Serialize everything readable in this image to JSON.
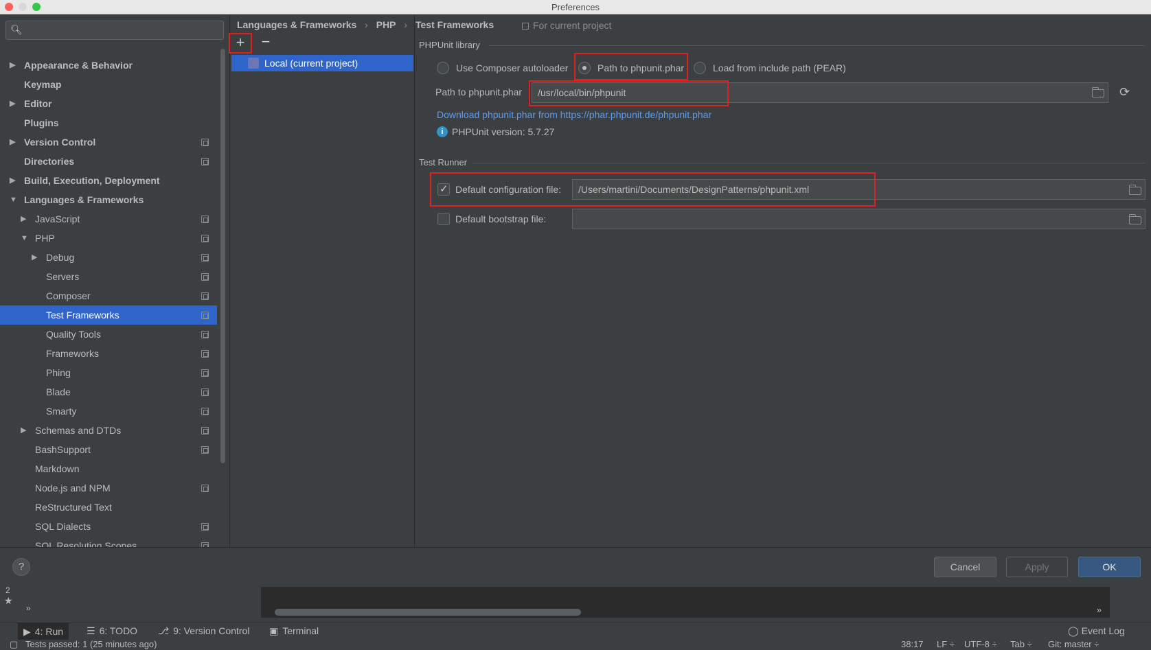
{
  "window": {
    "title": "Preferences"
  },
  "search": {
    "placeholder": ""
  },
  "tree": {
    "items": [
      {
        "label": "Appearance & Behavior",
        "bold": true,
        "arrow": "▶",
        "indent": 0,
        "copy": false
      },
      {
        "label": "Keymap",
        "bold": true,
        "arrow": "",
        "indent": 0,
        "copy": false
      },
      {
        "label": "Editor",
        "bold": true,
        "arrow": "▶",
        "indent": 0,
        "copy": false
      },
      {
        "label": "Plugins",
        "bold": true,
        "arrow": "",
        "indent": 0,
        "copy": false
      },
      {
        "label": "Version Control",
        "bold": true,
        "arrow": "▶",
        "indent": 0,
        "copy": true
      },
      {
        "label": "Directories",
        "bold": true,
        "arrow": "",
        "indent": 0,
        "copy": true
      },
      {
        "label": "Build, Execution, Deployment",
        "bold": true,
        "arrow": "▶",
        "indent": 0,
        "copy": false
      },
      {
        "label": "Languages & Frameworks",
        "bold": true,
        "arrow": "▼",
        "indent": 0,
        "copy": false
      },
      {
        "label": "JavaScript",
        "bold": false,
        "arrow": "▶",
        "indent": 1,
        "copy": true
      },
      {
        "label": "PHP",
        "bold": false,
        "arrow": "▼",
        "indent": 1,
        "copy": true
      },
      {
        "label": "Debug",
        "bold": false,
        "arrow": "▶",
        "indent": 2,
        "copy": true
      },
      {
        "label": "Servers",
        "bold": false,
        "arrow": "",
        "indent": 2,
        "copy": true
      },
      {
        "label": "Composer",
        "bold": false,
        "arrow": "",
        "indent": 2,
        "copy": true
      },
      {
        "label": "Test Frameworks",
        "bold": false,
        "arrow": "",
        "indent": 2,
        "copy": true,
        "selected": true
      },
      {
        "label": "Quality Tools",
        "bold": false,
        "arrow": "",
        "indent": 2,
        "copy": true
      },
      {
        "label": "Frameworks",
        "bold": false,
        "arrow": "",
        "indent": 2,
        "copy": true
      },
      {
        "label": "Phing",
        "bold": false,
        "arrow": "",
        "indent": 2,
        "copy": true
      },
      {
        "label": "Blade",
        "bold": false,
        "arrow": "",
        "indent": 2,
        "copy": true
      },
      {
        "label": "Smarty",
        "bold": false,
        "arrow": "",
        "indent": 2,
        "copy": true
      },
      {
        "label": "Schemas and DTDs",
        "bold": false,
        "arrow": "▶",
        "indent": 1,
        "copy": true
      },
      {
        "label": "BashSupport",
        "bold": false,
        "arrow": "",
        "indent": 1,
        "copy": true
      },
      {
        "label": "Markdown",
        "bold": false,
        "arrow": "",
        "indent": 1,
        "copy": false
      },
      {
        "label": "Node.js and NPM",
        "bold": false,
        "arrow": "",
        "indent": 1,
        "copy": true
      },
      {
        "label": "ReStructured Text",
        "bold": false,
        "arrow": "",
        "indent": 1,
        "copy": false
      },
      {
        "label": "SQL Dialects",
        "bold": false,
        "arrow": "",
        "indent": 1,
        "copy": true
      },
      {
        "label": "SQL Resolution Scopes",
        "bold": false,
        "arrow": "",
        "indent": 1,
        "copy": true
      }
    ]
  },
  "breadcrumb": {
    "part1": "Languages & Frameworks",
    "part2": "PHP",
    "part3": "Test Frameworks",
    "sep": "›",
    "scope": "For current project"
  },
  "list": {
    "add": "+",
    "remove": "−",
    "item": "Local (current project)",
    "item_icon": "php"
  },
  "phpunit": {
    "section": "PHPUnit library",
    "radio1": "Use Composer autoloader",
    "radio2": "Path to phpunit.phar",
    "radio3": "Load from include path (PEAR)",
    "path_label": "Path to phpunit.phar",
    "path_value": "/usr/local/bin/phpunit",
    "download_link": "Download phpunit.phar from https://phar.phpunit.de/phpunit.phar",
    "version": "PHPUnit version: 5.7.27"
  },
  "runner": {
    "section": "Test Runner",
    "config_label": "Default configuration file:",
    "config_value": "/Users/martini/Documents/DesignPatterns/phpunit.xml",
    "bootstrap_label": "Default bootstrap file:",
    "bootstrap_value": ""
  },
  "buttons": {
    "help": "?",
    "cancel": "Cancel",
    "apply": "Apply",
    "ok": "OK"
  },
  "ide": {
    "tab_run": "4: Run",
    "tab_todo": "6: TODO",
    "tab_vc": "9: Version Control",
    "tab_terminal": "Terminal",
    "event_log": "Event Log",
    "status_left": "Tests passed: 1 (25 minutes ago)",
    "status_pos": "38:17",
    "status_lf": "LF ÷",
    "status_enc": "UTF-8 ÷",
    "status_tab": "Tab ÷",
    "status_git": "Git: master ÷",
    "side_num": "2",
    "chevron": "»"
  },
  "colors": {
    "accent": "#2f65ca",
    "highlight": "#e02020",
    "link": "#589df6",
    "primary_button": "#365880"
  }
}
